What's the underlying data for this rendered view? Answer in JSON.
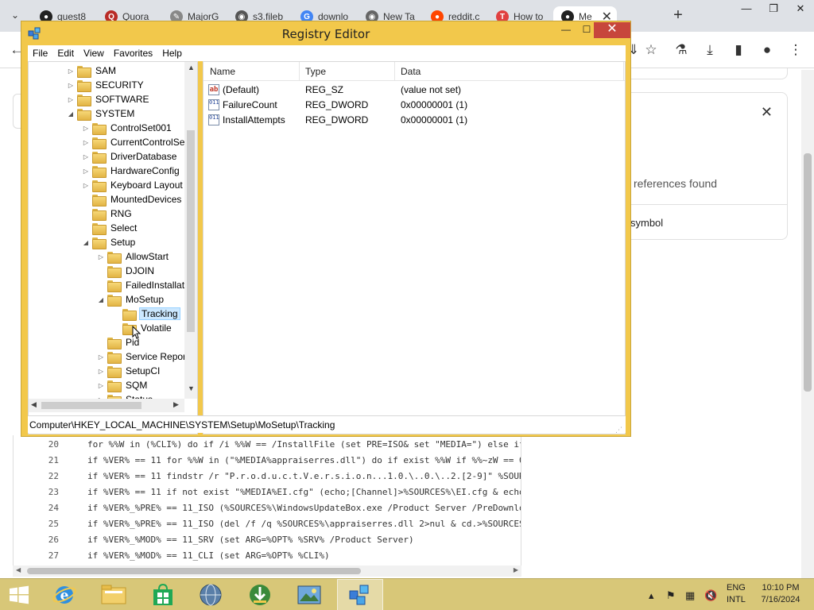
{
  "browser": {
    "tabs": [
      {
        "title": "quest8",
        "fav_color": "#222222",
        "fav_glyph": "●"
      },
      {
        "title": "Quora",
        "fav_color": "#b92b27",
        "fav_glyph": "Q"
      },
      {
        "title": "MajorG",
        "fav_color": "#888888",
        "fav_glyph": "✎"
      },
      {
        "title": "s3.fileb",
        "fav_color": "#555555",
        "fav_glyph": "◉"
      },
      {
        "title": "downlo",
        "fav_color": "#4285f4",
        "fav_glyph": "G"
      },
      {
        "title": "New Ta",
        "fav_color": "#666666",
        "fav_glyph": "◉"
      },
      {
        "title": "reddit.c",
        "fav_color": "#ff4500",
        "fav_glyph": "●"
      },
      {
        "title": "How to",
        "fav_color": "#e04040",
        "fav_glyph": "T"
      },
      {
        "title": "Me",
        "fav_color": "#222222",
        "fav_glyph": "●"
      }
    ],
    "tab_close": "✕",
    "new_tab": "+",
    "window_controls": {
      "minimize": "—",
      "restore": "❐",
      "close": "✕"
    },
    "side_card": {
      "close": "✕",
      "references_text": "references found",
      "symbol_text": "symbol"
    }
  },
  "code": {
    "lines": [
      {
        "num": "20",
        "text": "for %%W in (%CLI%) do if /i %%W == /InstallFile (set PRE=ISO& set \"MEDIA=\") else if"
      },
      {
        "num": "21",
        "text": "if %VER% == 11 for %%W in (\"%MEDIA%appraiserres.dll\") do if exist %%W if %%~zW == 0"
      },
      {
        "num": "22",
        "text": "if %VER% == 11 findstr /r \"P.r.o.d.u.c.t.V.e.r.s.i.o.n...1.0.\\..0.\\..2.[2-9]\" %SOUR"
      },
      {
        "num": "23",
        "text": "if %VER% == 11 if not exist \"%MEDIA%EI.cfg\" (echo;[Channel]>%SOURCES%\\EI.cfg & echo"
      },
      {
        "num": "24",
        "text": "if %VER%_%PRE% == 11_ISO (%SOURCES%\\WindowsUpdateBox.exe /Product Server /PreDownlo"
      },
      {
        "num": "25",
        "text": "if %VER%_%PRE% == 11_ISO (del /f /q %SOURCES%\\appraiserres.dll 2>nul & cd.>%SOURCES"
      },
      {
        "num": "26",
        "text": "if %VER%_%MOD% == 11_SRV (set ARG=%OPT% %SRV% /Product Server)"
      },
      {
        "num": "27",
        "text": "if %VER%_%MOD% == 11_CLI (set ARG=%OPT% %CLI%)"
      }
    ]
  },
  "regedit": {
    "title": "Registry Editor",
    "menu": [
      "File",
      "Edit",
      "View",
      "Favorites",
      "Help"
    ],
    "tree": [
      {
        "label": "SAM",
        "indent": 0,
        "exp": "▷"
      },
      {
        "label": "SECURITY",
        "indent": 0,
        "exp": "▷"
      },
      {
        "label": "SOFTWARE",
        "indent": 0,
        "exp": "▷"
      },
      {
        "label": "SYSTEM",
        "indent": 0,
        "exp": "◢"
      },
      {
        "label": "ControlSet001",
        "indent": 1,
        "exp": "▷"
      },
      {
        "label": "CurrentControlSet",
        "indent": 1,
        "exp": "▷"
      },
      {
        "label": "DriverDatabase",
        "indent": 1,
        "exp": "▷"
      },
      {
        "label": "HardwareConfig",
        "indent": 1,
        "exp": "▷"
      },
      {
        "label": "Keyboard Layout",
        "indent": 1,
        "exp": "▷"
      },
      {
        "label": "MountedDevices",
        "indent": 1,
        "exp": ""
      },
      {
        "label": "RNG",
        "indent": 1,
        "exp": ""
      },
      {
        "label": "Select",
        "indent": 1,
        "exp": ""
      },
      {
        "label": "Setup",
        "indent": 1,
        "exp": "◢"
      },
      {
        "label": "AllowStart",
        "indent": 2,
        "exp": "▷"
      },
      {
        "label": "DJOIN",
        "indent": 2,
        "exp": ""
      },
      {
        "label": "FailedInstallati",
        "indent": 2,
        "exp": ""
      },
      {
        "label": "MoSetup",
        "indent": 2,
        "exp": "◢"
      },
      {
        "label": "Tracking",
        "indent": 3,
        "exp": "",
        "selected": true
      },
      {
        "label": "Volatile",
        "indent": 3,
        "exp": ""
      },
      {
        "label": "Pid",
        "indent": 2,
        "exp": ""
      },
      {
        "label": "Service Report",
        "indent": 2,
        "exp": "▷"
      },
      {
        "label": "SetupCI",
        "indent": 2,
        "exp": "▷"
      },
      {
        "label": "SQM",
        "indent": 2,
        "exp": "▷"
      },
      {
        "label": "Status",
        "indent": 2,
        "exp": "▷"
      }
    ],
    "columns": {
      "name": "Name",
      "type": "Type",
      "data": "Data"
    },
    "values": [
      {
        "name": "(Default)",
        "type": "REG_SZ",
        "data": "(value not set)",
        "icon": "ab"
      },
      {
        "name": "FailureCount",
        "type": "REG_DWORD",
        "data": "0x00000001 (1)",
        "icon": "011"
      },
      {
        "name": "InstallAttempts",
        "type": "REG_DWORD",
        "data": "0x00000001 (1)",
        "icon": "011"
      }
    ],
    "status_path": "Computer\\HKEY_LOCAL_MACHINE\\SYSTEM\\Setup\\MoSetup\\Tracking"
  },
  "taskbar": {
    "tray_lang": "ENG",
    "tray_layout": "INTL",
    "time": "10:10 PM",
    "date": "7/16/2024"
  }
}
